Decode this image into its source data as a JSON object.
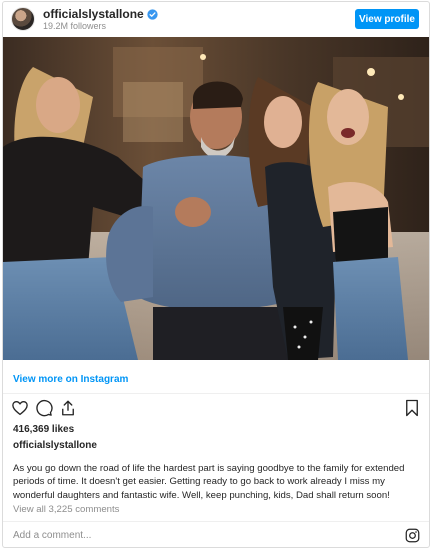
{
  "header": {
    "username": "officialslystallone",
    "followers": "19.2M followers",
    "view_profile_label": "View profile"
  },
  "post": {
    "view_more_label": "View more on Instagram",
    "likes": "416,369 likes",
    "poster": "officialslystallone",
    "caption": "As you go down the road of life the hardest part is saying goodbye to the family for extended periods of time. It doesn't get easier. Getting ready to go back to work already I miss my wonderful daughters and fantastic wife. Well, keep punching, kids, Dad shall return soon!",
    "view_comments": "View all 3,225 comments"
  },
  "comment_bar": {
    "placeholder": "Add a comment..."
  },
  "icons": {
    "verified": "verified-badge-icon",
    "like": "heart-icon",
    "comment": "comment-icon",
    "share": "share-icon",
    "save": "bookmark-icon",
    "instagram": "instagram-icon"
  },
  "colors": {
    "accent": "#0095f6",
    "text": "#262626",
    "muted": "#8e8e8e",
    "border": "#dbdbdb"
  }
}
